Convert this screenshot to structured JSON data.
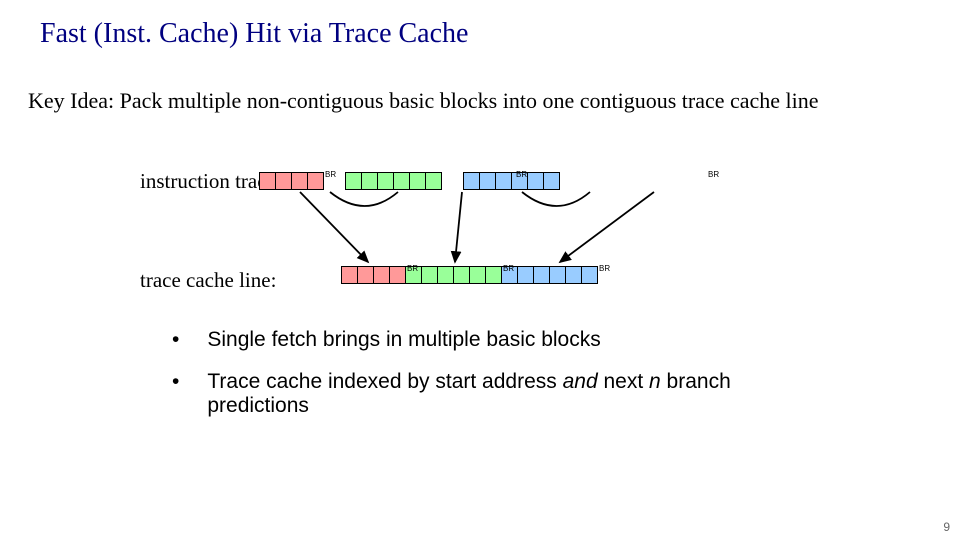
{
  "title": "Fast (Inst. Cache) Hit via Trace Cache",
  "key_idea": "Key Idea: Pack multiple non-contiguous basic blocks into one contiguous trace cache line",
  "labels": {
    "instr": "instruction trace:",
    "tcl": "trace cache line:",
    "br": "BR"
  },
  "bullets": {
    "b1": "Single fetch brings in multiple basic blocks",
    "b2_a": "Trace cache indexed by start address ",
    "b2_and": "and",
    "b2_b": " next ",
    "b2_n": "n",
    "b2_c": " branch predictions"
  },
  "page_num": "9",
  "chart_data": {
    "type": "diagram",
    "instruction_trace": [
      {
        "color": "red",
        "cells": 4,
        "ends_with_branch": true
      },
      {
        "color": "green",
        "cells": 6,
        "ends_with_branch": true
      },
      {
        "color": "blue",
        "cells": 6,
        "ends_with_branch": true
      }
    ],
    "trace_cache_line": [
      {
        "color": "red",
        "cells": 4,
        "ends_with_branch": true
      },
      {
        "color": "green",
        "cells": 6,
        "ends_with_branch": true
      },
      {
        "color": "blue",
        "cells": 6,
        "ends_with_branch": true
      }
    ],
    "arrows": [
      "red-block-end -> green-block-start (trace)",
      "green-block-end -> blue-block-start (trace)",
      "red-trace -> red-cacheline",
      "green-trace -> green-cacheline",
      "blue-trace -> blue-cacheline"
    ]
  }
}
